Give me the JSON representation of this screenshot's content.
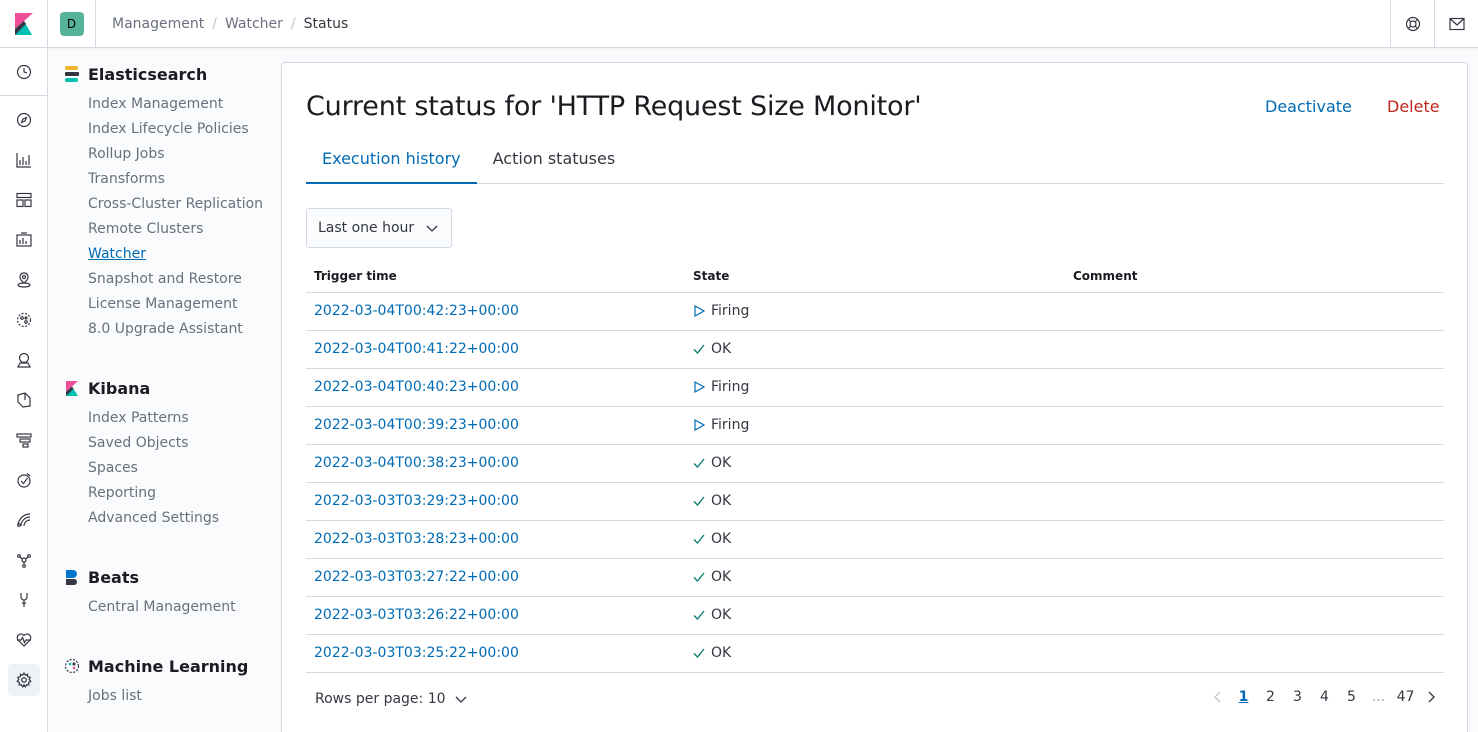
{
  "header": {
    "space_initial": "D",
    "breadcrumbs": [
      "Management",
      "Watcher",
      "Status"
    ]
  },
  "sidenav": {
    "groups": [
      {
        "title": "Elasticsearch",
        "items": [
          "Index Management",
          "Index Lifecycle Policies",
          "Rollup Jobs",
          "Transforms",
          "Cross-Cluster Replication",
          "Remote Clusters",
          "Watcher",
          "Snapshot and Restore",
          "License Management",
          "8.0 Upgrade Assistant"
        ],
        "selected": "Watcher"
      },
      {
        "title": "Kibana",
        "items": [
          "Index Patterns",
          "Saved Objects",
          "Spaces",
          "Reporting",
          "Advanced Settings"
        ]
      },
      {
        "title": "Beats",
        "items": [
          "Central Management"
        ]
      },
      {
        "title": "Machine Learning",
        "items": [
          "Jobs list"
        ]
      }
    ]
  },
  "main": {
    "title": "Current status for 'HTTP Request Size Monitor'",
    "deactivate_label": "Deactivate",
    "delete_label": "Delete",
    "tabs": [
      {
        "label": "Execution history",
        "active": true
      },
      {
        "label": "Action statuses",
        "active": false
      }
    ],
    "time_filter": "Last one hour",
    "table": {
      "columns": [
        "Trigger time",
        "State",
        "Comment"
      ],
      "rows": [
        {
          "time": "2022-03-04T00:42:23+00:00",
          "state": "Firing",
          "comment": ""
        },
        {
          "time": "2022-03-04T00:41:22+00:00",
          "state": "OK",
          "comment": ""
        },
        {
          "time": "2022-03-04T00:40:23+00:00",
          "state": "Firing",
          "comment": ""
        },
        {
          "time": "2022-03-04T00:39:23+00:00",
          "state": "Firing",
          "comment": ""
        },
        {
          "time": "2022-03-04T00:38:23+00:00",
          "state": "OK",
          "comment": ""
        },
        {
          "time": "2022-03-03T03:29:23+00:00",
          "state": "OK",
          "comment": ""
        },
        {
          "time": "2022-03-03T03:28:23+00:00",
          "state": "OK",
          "comment": ""
        },
        {
          "time": "2022-03-03T03:27:22+00:00",
          "state": "OK",
          "comment": ""
        },
        {
          "time": "2022-03-03T03:26:22+00:00",
          "state": "OK",
          "comment": ""
        },
        {
          "time": "2022-03-03T03:25:22+00:00",
          "state": "OK",
          "comment": ""
        }
      ]
    },
    "rows_per_page_label": "Rows per page: 10",
    "pagination": {
      "pages": [
        "1",
        "2",
        "3",
        "4",
        "5",
        "...",
        "47"
      ],
      "current": "1"
    }
  },
  "colors": {
    "accent": "#006bb4",
    "danger": "#bd271e",
    "border": "#d3dae6",
    "space_avatar": "#54b399"
  }
}
